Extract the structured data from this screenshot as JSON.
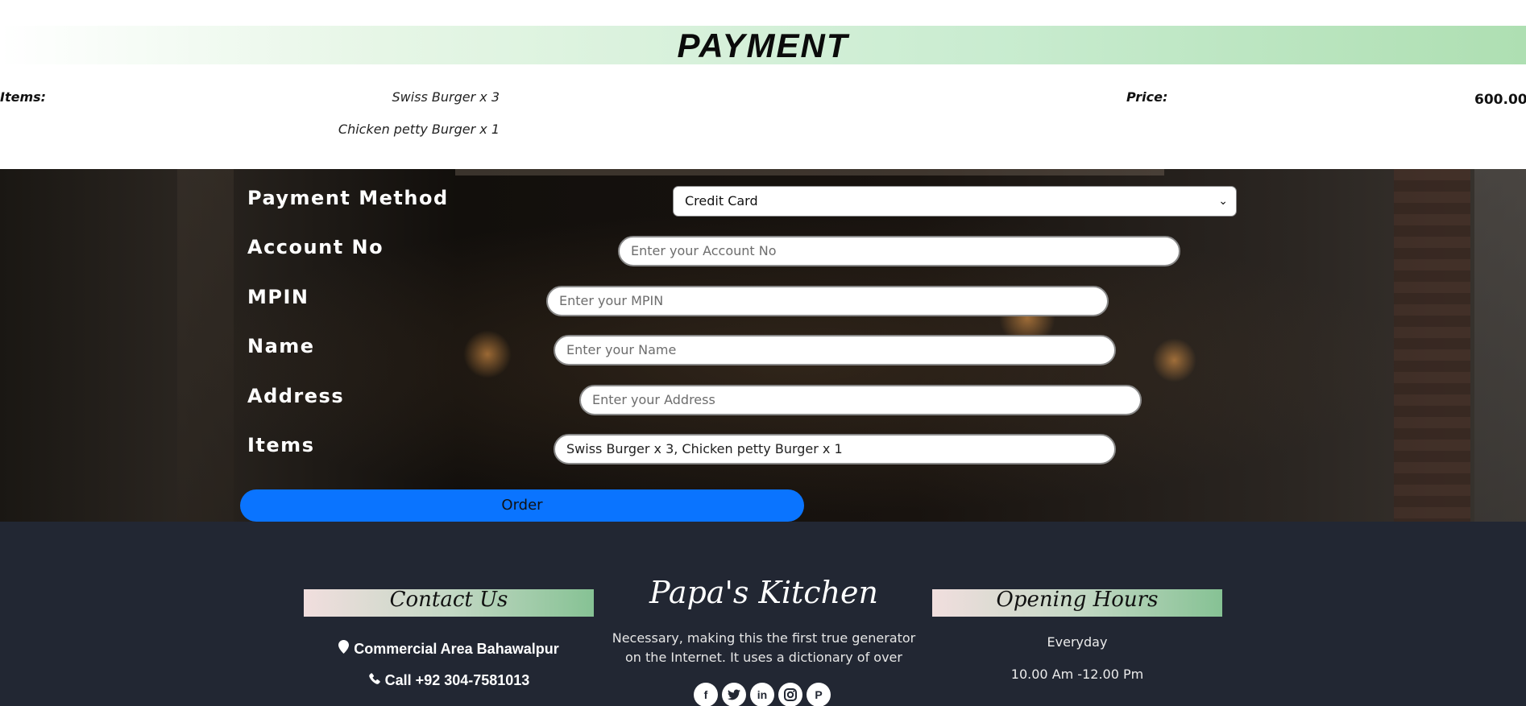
{
  "summary": {
    "title": "PAYMENT",
    "items_label": "Items:",
    "items": [
      "Swiss Burger x 3",
      "Chicken petty Burger x 1"
    ],
    "price_label": "Price:",
    "price_value": "600.00"
  },
  "form": {
    "payment_method_label": "Payment Method",
    "payment_method_value": "Credit Card",
    "account_label": "Account No",
    "account_placeholder": "Enter your Account No",
    "mpin_label": "MPIN",
    "mpin_placeholder": "Enter your MPIN",
    "name_label": "Name",
    "name_placeholder": "Enter your Name",
    "address_label": "Address",
    "address_placeholder": "Enter your Address",
    "items_label": "Items",
    "items_value": "Swiss Burger x 3, Chicken petty Burger x 1",
    "order_button": "Order"
  },
  "footer": {
    "contact_title": "Contact Us",
    "contact_address": "Commercial Area Bahawalpur",
    "contact_phone": "Call +92 304-7581013",
    "brand": "Papa's Kitchen",
    "brand_desc_line1": "Necessary, making this the first true generator",
    "brand_desc_line2": "on the Internet. It uses a dictionary of over",
    "hours_title": "Opening Hours",
    "hours_days": "Everyday",
    "hours_time": "10.00 Am -12.00 Pm",
    "social_icons": [
      "facebook-icon",
      "twitter-icon",
      "linkedin-icon",
      "instagram-icon",
      "pinterest-icon"
    ]
  },
  "colors": {
    "accent_button": "#0a74ff",
    "footer_bg": "#222733",
    "title_gradient_end": "#aedfb2"
  }
}
